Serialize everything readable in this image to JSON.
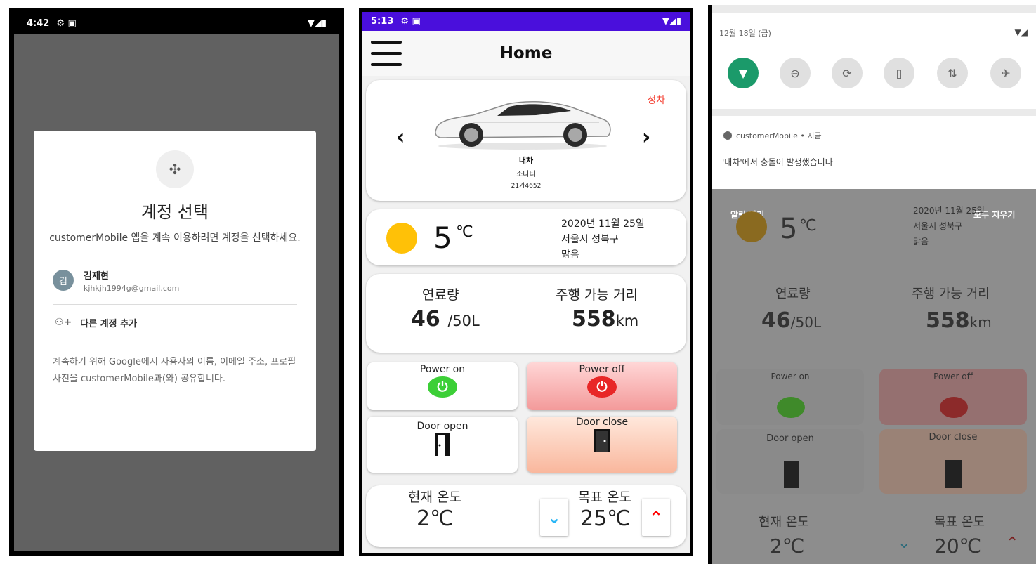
{
  "phone1": {
    "status": {
      "time": "4:42",
      "left_icons": "⚙ ▣",
      "right_icons": "▼◢▮"
    },
    "dialog": {
      "title": "계정 선택",
      "subtitle": "customerMobile 앱을 계속 이용하려면 계정을 선택하세요.",
      "account": {
        "avatar_letter": "김",
        "name": "김재현",
        "email": "kjhkjh1994g@gmail.com"
      },
      "add_account": "다른 계정 추가",
      "disclaimer": "계속하기 위해 Google에서 사용자의 이름, 이메일 주소, 프로필 사진을 customerMobile과(와) 공유합니다."
    }
  },
  "phone2": {
    "status": {
      "time": "5:13",
      "left_icons": "⚙ ▣",
      "right_icons": "▼◢▮"
    },
    "appbar": {
      "title": "Home"
    },
    "car": {
      "status": "정차",
      "name": "내차",
      "model": "소나타",
      "plate": "21가4652",
      "prev": "‹",
      "next": "›"
    },
    "weather": {
      "temp": "5",
      "unit": "℃",
      "date": "2020년 11월 25일",
      "location": "서울시 성북구",
      "condition": "맑음"
    },
    "fuel": {
      "fuel_label": "연료량",
      "fuel_value": "46",
      "fuel_unit": "/50L",
      "range_label": "주행 가능 거리",
      "range_value": "558",
      "range_unit": "km"
    },
    "controls": {
      "power_on": "Power on",
      "power_off": "Power off",
      "door_open": "Door open",
      "door_close": "Door close",
      "power_icon": "⏻"
    },
    "climate": {
      "current_label": "현재 온도",
      "current_value": "2℃",
      "target_label": "목표 온도",
      "target_value": "25℃",
      "down": "⌄",
      "up": "⌃"
    }
  },
  "phone3": {
    "date": "12월 18일 (금)",
    "notification": {
      "app": "customerMobile • 지금",
      "message": "'내차'에서 충돌이 발생했습니다"
    },
    "manage": "알림 관리",
    "clear_all": "모두 지우기",
    "background": {
      "temp": "5",
      "unit": "℃",
      "date": "2020년 11월 25일",
      "location": "서울시 성북구",
      "condition": "맑음",
      "fuel_label": "연료량",
      "fuel_value": "46",
      "fuel_unit": "/50L",
      "range_label": "주행 가능 거리",
      "range_value": "558",
      "range_unit": "km",
      "power_on": "Power on",
      "power_off": "Power off",
      "door_open": "Door open",
      "door_close": "Door close",
      "current_label": "현재 온도",
      "current_value": "2℃",
      "target_label": "목표 온도",
      "target_value": "20℃"
    }
  },
  "colors": {
    "status_bar_purple": "#4a0fdc",
    "power_on_green": "#3ccf37",
    "power_off_red": "#e82727",
    "parked_red": "#f44336",
    "wifi_green": "#1b9a6a"
  }
}
